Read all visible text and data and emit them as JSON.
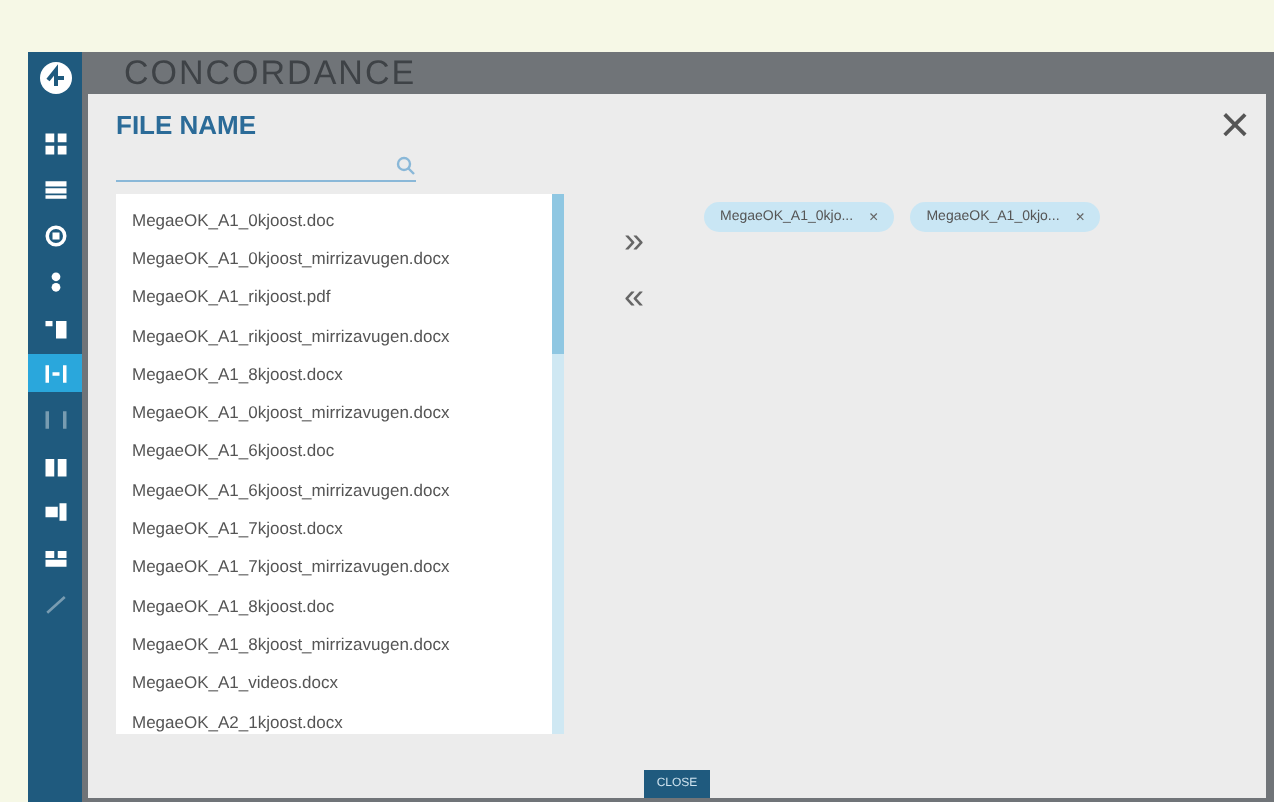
{
  "app": {
    "title": "CONCORDANCE"
  },
  "sidebar": {
    "items": [
      {
        "selected": false
      },
      {
        "selected": false
      },
      {
        "selected": false
      },
      {
        "selected": false
      },
      {
        "selected": false
      },
      {
        "selected": true
      },
      {
        "selected": false
      },
      {
        "selected": false
      },
      {
        "selected": false
      },
      {
        "selected": false
      },
      {
        "selected": false
      }
    ]
  },
  "dialog": {
    "title": "FILE NAME",
    "close_label": "×",
    "move_right": "»",
    "move_left": "«",
    "files": [
      {
        "name": "MegaeOK_A1_0kjoost.doc"
      },
      {
        "name": "MegaeOK_A1_0kjoost_mirrizavugen.docx"
      },
      {
        "name": "MegaeOK_A1_rikjoost.pdf"
      },
      {
        "name": "MegaeOK_A1_rikjoost_mirrizavugen.docx"
      },
      {
        "name": "MegaeOK_A1_8kjoost.docx"
      },
      {
        "name": "MegaeOK_A1_0kjoost_mirrizavugen.docx"
      },
      {
        "name": "MegaeOK_A1_6kjoost.doc"
      },
      {
        "name": "MegaeOK_A1_6kjoost_mirrizavugen.docx"
      },
      {
        "name": "MegaeOK_A1_7kjoost.docx"
      },
      {
        "name": "MegaeOK_A1_7kjoost_mirrizavugen.docx"
      },
      {
        "name": "MegaeOK_A1_8kjoost.doc"
      },
      {
        "name": "MegaeOK_A1_8kjoost_mirrizavugen.docx"
      },
      {
        "name": "MegaeOK_A1_videos.docx"
      },
      {
        "name": "MegaeOK_A2_1kjoost.docx"
      }
    ],
    "chips": [
      {
        "label": "MegaeOK_A1_0kjo...",
        "remove": "×"
      },
      {
        "label": "MegaeOK_A1_0kjo...",
        "remove": "×"
      }
    ],
    "button": "CLOSE"
  }
}
